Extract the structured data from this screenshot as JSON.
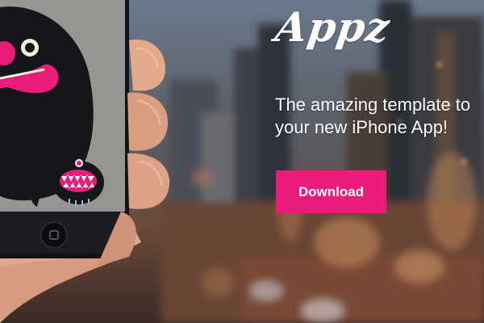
{
  "brand": {
    "logo_text": "Appz"
  },
  "hero": {
    "tagline_line1": "The amazing template to",
    "tagline_line2": "your new iPhone App!",
    "download_label": "Download"
  },
  "colors": {
    "accent": "#ec1c7b",
    "text": "#ffffff"
  },
  "icons": {
    "home_button": "home-button-icon"
  }
}
